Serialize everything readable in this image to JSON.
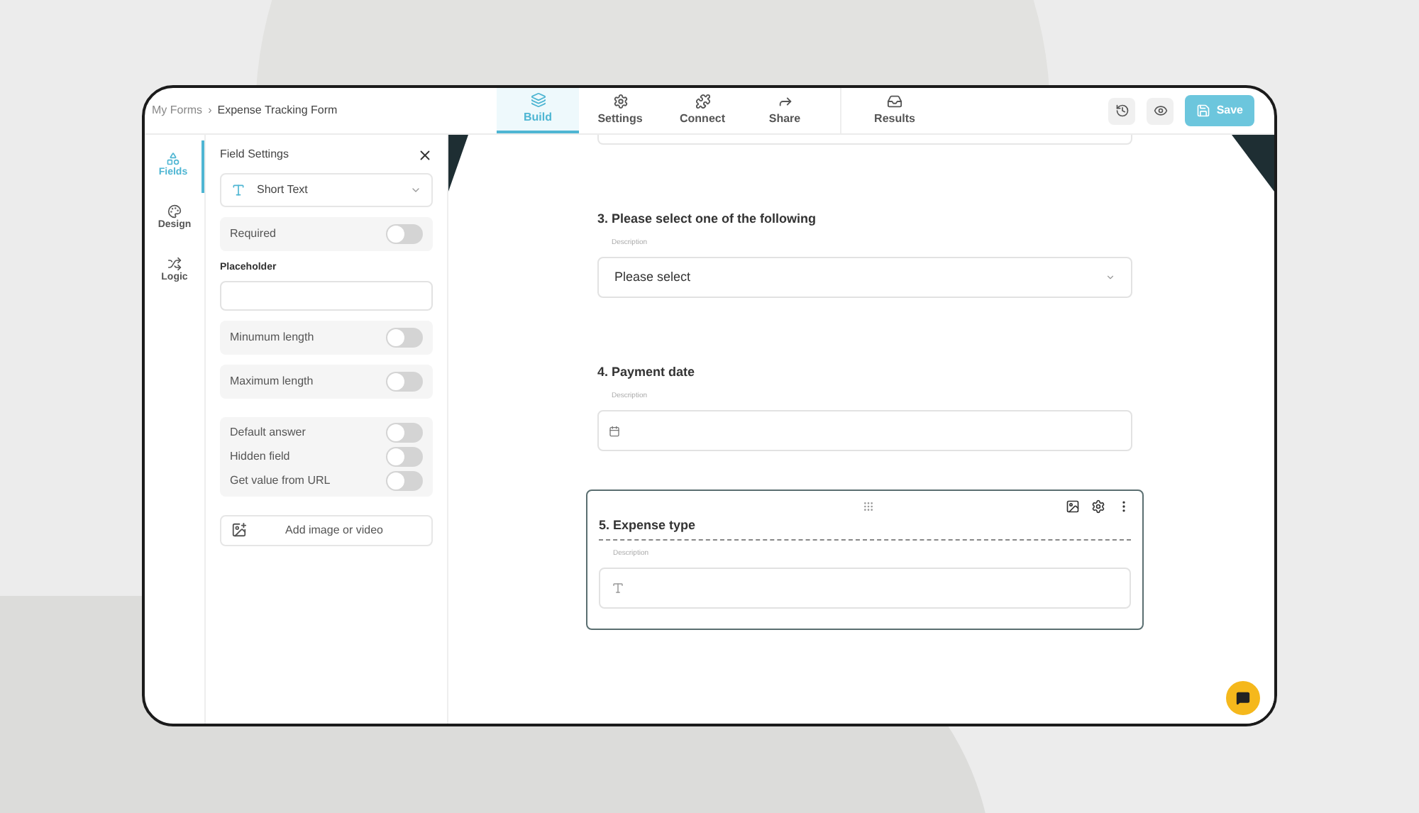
{
  "breadcrumb": {
    "items": [
      "My Forms",
      "Expense Tracking Form"
    ],
    "separator": "›"
  },
  "tabs": [
    {
      "label": "Build",
      "selected": true
    },
    {
      "label": "Settings",
      "selected": false
    },
    {
      "label": "Connect",
      "selected": false
    },
    {
      "label": "Share",
      "selected": false
    },
    {
      "label": "Results",
      "selected": false
    }
  ],
  "save_button": "Save",
  "sidebar": {
    "items": [
      {
        "label": "Fields",
        "selected": true
      },
      {
        "label": "Design",
        "selected": false
      },
      {
        "label": "Logic",
        "selected": false
      }
    ]
  },
  "field_settings": {
    "title": "Field Settings",
    "field_type": "Short Text",
    "groups": [
      {
        "toggles": [
          {
            "label": "Required",
            "on": false
          }
        ]
      },
      {
        "field_label": "Placeholder"
      },
      {
        "toggles": [
          {
            "label": "Minumum length",
            "on": false
          }
        ]
      },
      {
        "toggles": [
          {
            "label": "Maximum length",
            "on": false
          }
        ]
      },
      {
        "toggles": [
          {
            "label": "Default answer",
            "on": false
          },
          {
            "label": "Hidden field",
            "on": false
          },
          {
            "label": "Get value from URL",
            "on": false
          }
        ]
      }
    ],
    "add_media": "Add image or video"
  },
  "questions": [
    {
      "kind": "select",
      "title": "3. Please select one of the following",
      "description": "Description",
      "value": "Please select",
      "selected": false
    },
    {
      "kind": "date",
      "title": "4. Payment date",
      "description": "Description",
      "selected": false
    },
    {
      "kind": "text",
      "title": "5. Expense type",
      "description": "Description",
      "selected": true
    }
  ]
}
